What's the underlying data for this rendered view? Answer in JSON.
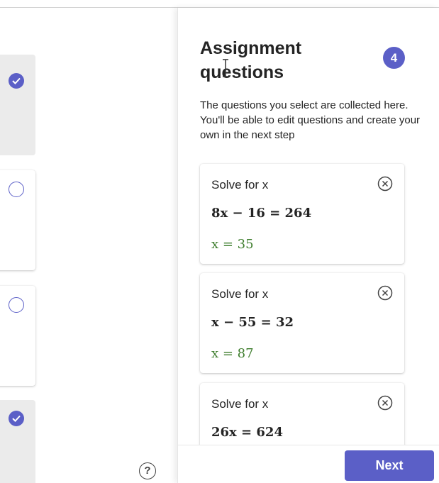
{
  "panel": {
    "title": "Assignment questions",
    "count": "4",
    "description": "The questions you select are collected here. You'll be able to edit questions and create your own in the next step"
  },
  "selected_questions": [
    {
      "prompt": "Solve for x",
      "equation": "8x − 16 = 264",
      "answer": "x = 35"
    },
    {
      "prompt": "Solve for x",
      "equation": "x − 55 = 32",
      "answer": "x = 87"
    },
    {
      "prompt": "Solve for x",
      "equation": "26x = 624",
      "answer": ""
    }
  ],
  "left_cards": [
    {
      "selected": true
    },
    {
      "selected": false
    },
    {
      "selected": false
    },
    {
      "selected": true
    }
  ],
  "footer": {
    "next_label": "Next",
    "help_glyph": "?"
  },
  "icons": {
    "remove": "close-circle-icon",
    "check": "checkmark-icon",
    "help": "help-circle-icon",
    "cursor": "text-cursor-icon"
  },
  "colors": {
    "accent": "#5b5fc7",
    "answer": "#3f7e2e"
  }
}
